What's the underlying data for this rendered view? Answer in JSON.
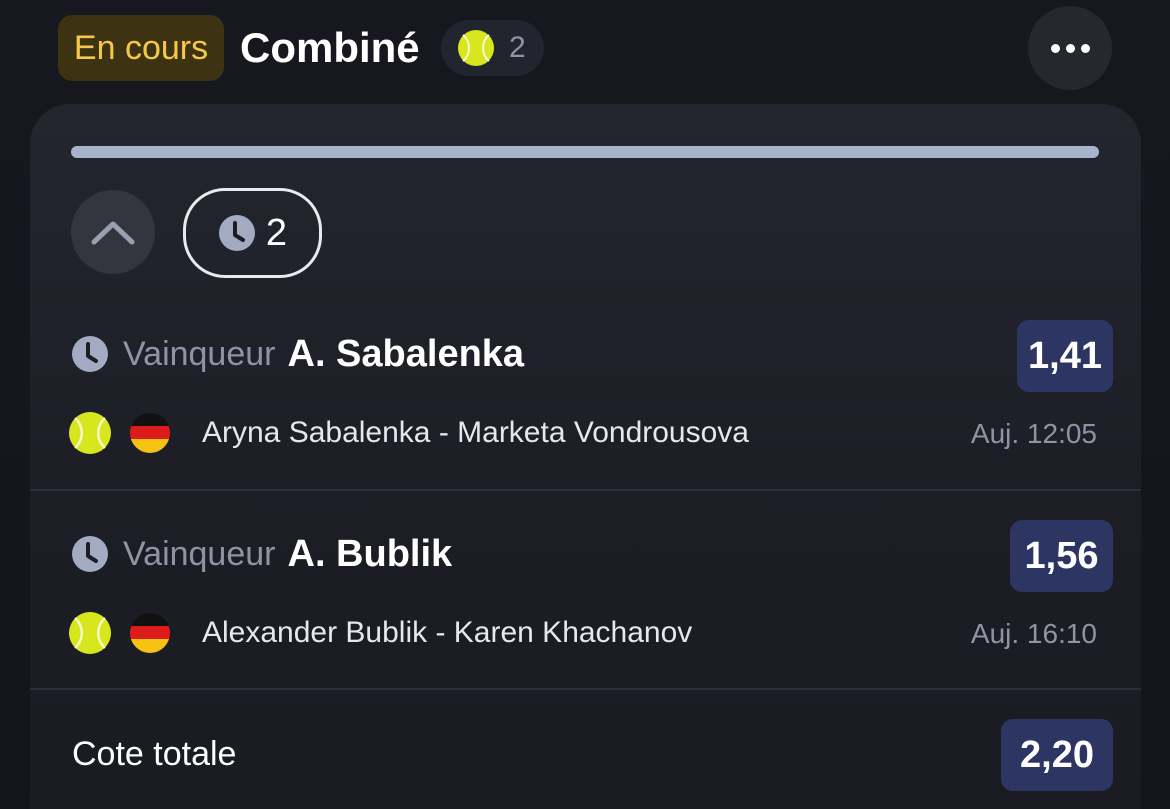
{
  "header": {
    "status_label": "En cours",
    "title": "Combiné",
    "sport_icon": "tennis-ball-icon",
    "selection_count": "2",
    "more_icon": "more-horizontal-icon"
  },
  "card": {
    "progress_fraction": 1.0,
    "collapse_icon": "chevron-up-icon",
    "pending_count": "2",
    "selections": [
      {
        "market": "Vainqueur",
        "pick": "A. Sabalenka",
        "odds": "1,41",
        "event": "Aryna Sabalenka - Marketa Vondrousova",
        "time": "Auj. 12:05",
        "sport_icon": "tennis-ball-icon",
        "flag_icon": "germany-flag-icon"
      },
      {
        "market": "Vainqueur",
        "pick": "A. Bublik",
        "odds": "1,56",
        "event": "Alexander Bublik - Karen Khachanov",
        "time": "Auj. 16:10",
        "sport_icon": "tennis-ball-icon",
        "flag_icon": "germany-flag-icon"
      }
    ],
    "total": {
      "label": "Cote totale",
      "odds": "2,20"
    }
  },
  "colors": {
    "status_text": "#f6c84a",
    "status_bg": "#3d3211",
    "odds_bg": "#2d3563",
    "muted_text": "#8f93a3",
    "progress": "#aab3cc"
  }
}
